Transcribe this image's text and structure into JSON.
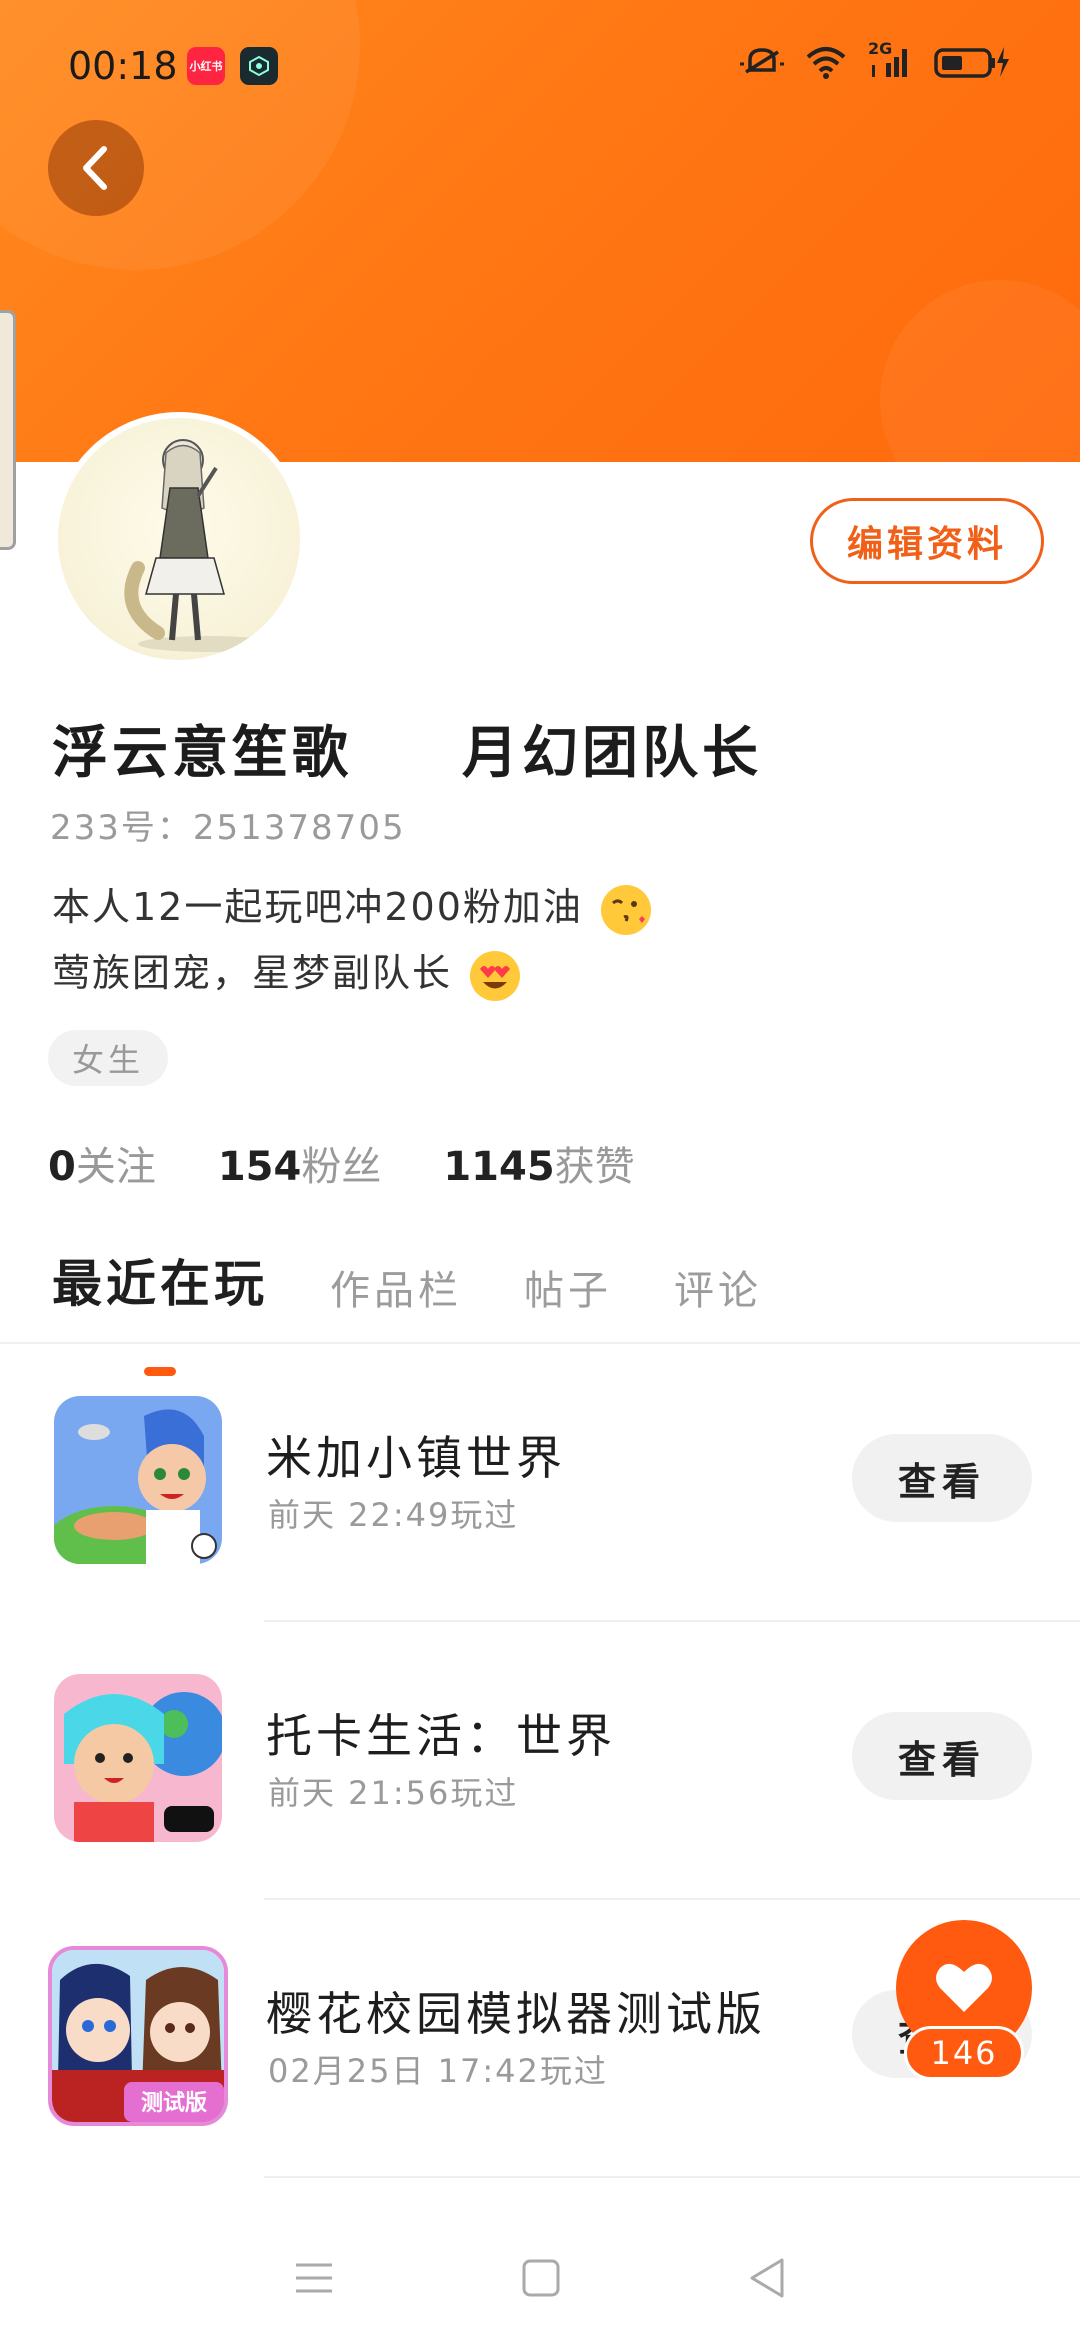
{
  "status": {
    "time": "00:18",
    "app_badge_1": "小红书",
    "network": "2G"
  },
  "colors": {
    "accent": "#ff6a0c",
    "accent_text": "#f06018",
    "muted": "#999999"
  },
  "profile": {
    "edit_label": "编辑资料",
    "name": "浮云意笙歌",
    "title": "月幻团队长",
    "uid": "233号：251378705",
    "bio_line1": "本人12一起玩吧冲200粉加油",
    "bio_line2": "莺族团宠，星梦副队长",
    "gender": "女生"
  },
  "stats": {
    "following_num": "0",
    "following_label": "关注",
    "fans_num": "154",
    "fans_label": "粉丝",
    "likes_num": "1145",
    "likes_label": "获赞"
  },
  "tabs": [
    "最近在玩",
    "作品栏",
    "帖子",
    "评论"
  ],
  "games": [
    {
      "title": "米加小镇世界",
      "time": "前天 22:49玩过",
      "button": "查看",
      "icon": "miga-town-icon"
    },
    {
      "title": "托卡生活：世界",
      "time": "前天 21:56玩过",
      "button": "查看",
      "icon": "toca-life-icon"
    },
    {
      "title": "樱花校园模拟器测试版",
      "time": "02月25日 17:42玩过",
      "button": "查看",
      "icon": "sakura-school-icon",
      "icon_text": "测试版"
    }
  ],
  "like_fab": {
    "count": "146"
  }
}
